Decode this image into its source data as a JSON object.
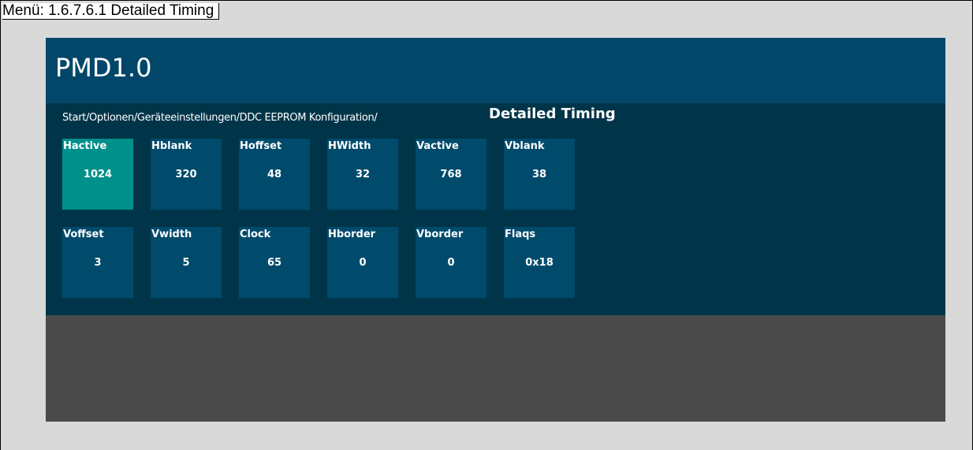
{
  "menu_title": "Menü: 1.6.7.6.1 Detailed Timing",
  "app": {
    "title": "PMD1.0",
    "breadcrumb": "Start/Optionen/Geräteeinstellungen/DDC EEPROM Konfiguration/",
    "page_heading": "Detailed Timing"
  },
  "tiles_row1": [
    {
      "label": "Hactive",
      "value": "1024"
    },
    {
      "label": "Hblank",
      "value": "320"
    },
    {
      "label": "Hoffset",
      "value": "48"
    },
    {
      "label": "HWidth",
      "value": "32"
    },
    {
      "label": "Vactive",
      "value": "768"
    },
    {
      "label": "Vblank",
      "value": "38"
    }
  ],
  "tiles_row2": [
    {
      "label": "Voffset",
      "value": "3"
    },
    {
      "label": "Vwidth",
      "value": "5"
    },
    {
      "label": "Clock",
      "value": "65"
    },
    {
      "label": "Hborder",
      "value": "0"
    },
    {
      "label": "Vborder",
      "value": "0"
    },
    {
      "label": "Flaqs",
      "value": "0x18"
    }
  ],
  "selected_tile": "Hactive",
  "colors": {
    "header_bg": "#02476a",
    "content_bg": "#003549",
    "tile_bg": "#004b6c",
    "tile_selected_bg": "#00908c",
    "footer_bg": "#4a4a4a",
    "outer_bg": "#d9d9d9"
  }
}
